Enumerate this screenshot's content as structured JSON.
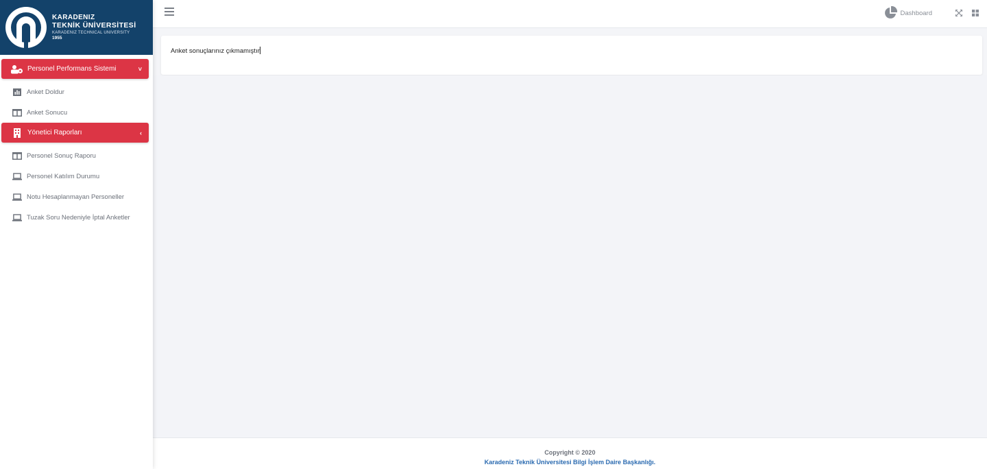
{
  "brand": {
    "line1": "KARADENIZ",
    "line2": "TEKNİK ÜNİVERSİTESİ",
    "line3": "KARADENIZ TECHNICAL UNIVERSITY",
    "year": "1955",
    "color": "#13426a"
  },
  "sidebar": {
    "groups": [
      {
        "label": "Personel Performans Sistemi",
        "icon": "users-cog-icon",
        "caret": "˅",
        "items": [
          {
            "label": "Anket Doldur",
            "icon": "bar-chart-icon"
          },
          {
            "label": "Anket Sonucu",
            "icon": "columns-icon"
          }
        ]
      },
      {
        "label": "Yönetici Raporları",
        "icon": "building-icon",
        "caret": "‹",
        "items": [
          {
            "label": "Personel Sonuç Raporu",
            "icon": "columns-icon"
          },
          {
            "label": "Personel Katılım Durumu",
            "icon": "laptop-icon"
          },
          {
            "label": "Notu Hesaplanmayan Personeller",
            "icon": "laptop-icon"
          },
          {
            "label": "Tuzak Soru Nedeniyle İptal Anketler",
            "icon": "laptop-icon"
          }
        ]
      }
    ],
    "accent": "#dc3545"
  },
  "topbar": {
    "dashboard_label": "Dashboard",
    "icons": [
      "hamburger-icon",
      "pie-chart-icon",
      "expand-icon",
      "grid-icon"
    ]
  },
  "main": {
    "message": "Anket sonuçlarınız çıkmamıştır"
  },
  "footer": {
    "copyright": "Copyright © 2020",
    "organization": "Karadeniz Teknik Üniversitesi Bilgi İşlem Daire Başkanlığı.",
    "link_color": "#2a6ab0"
  }
}
